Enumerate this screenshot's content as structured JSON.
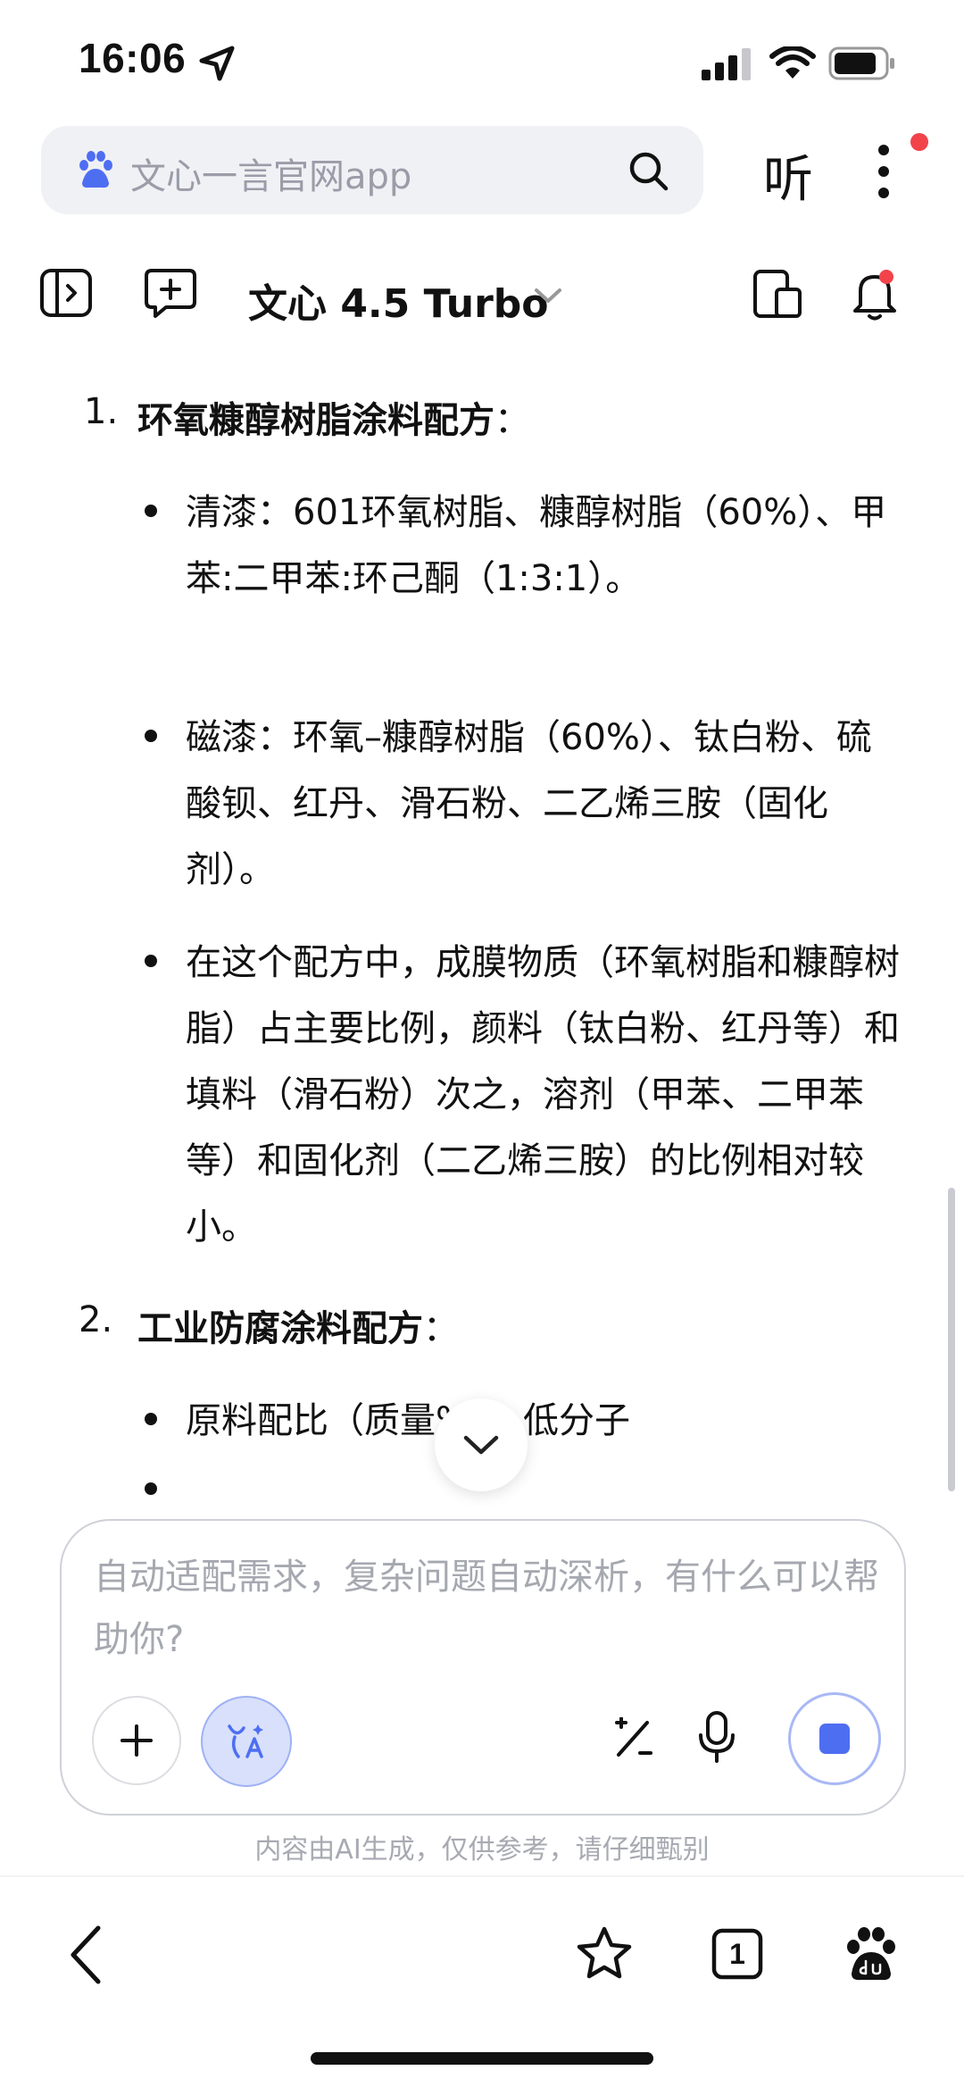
{
  "status_bar": {
    "time": "16:06"
  },
  "browser": {
    "search_placeholder": "文心一言官网app",
    "listen_label": "听"
  },
  "toolbar": {
    "model_name": "文心 4.5 Turbo"
  },
  "content": {
    "sections": [
      {
        "number": "1.",
        "title": "环氧糠醇树脂涂料配方",
        "colon": "：",
        "bullets": [
          "清漆：601环氧树脂、糠醇树脂（60%）、甲苯:二甲苯:环己酮（1:3:1）。",
          "磁漆：环氧–糠醇树脂（60%）、钛白粉、硫酸钡、红丹、滑石粉、二乙烯三胺（固化剂）。",
          "在这个配方中，成膜物质（环氧树脂和糠醇树脂）占主要比例，颜料（钛白粉、红丹等）和填料（滑石粉）次之，溶剂（甲苯、二甲苯等）和固化剂（二乙烯三胺）的比例相对较小。"
        ]
      },
      {
        "number": "2.",
        "title": "工业防腐涂料配方",
        "colon": "：",
        "bullets": [
          "原料配比（质量%）：低分子",
          ""
        ]
      }
    ]
  },
  "input": {
    "placeholder": "自动适配需求，复杂问题自动深析，有什么可以帮助你?"
  },
  "disclaimer": "内容由AI生成，仅供参考，请仔细甄别",
  "bottom_bar": {
    "tab_count": "1"
  },
  "colors": {
    "accent_blue": "#4e6ef2",
    "notification_red": "#f2434b",
    "search_bg": "#f0f1f5"
  }
}
